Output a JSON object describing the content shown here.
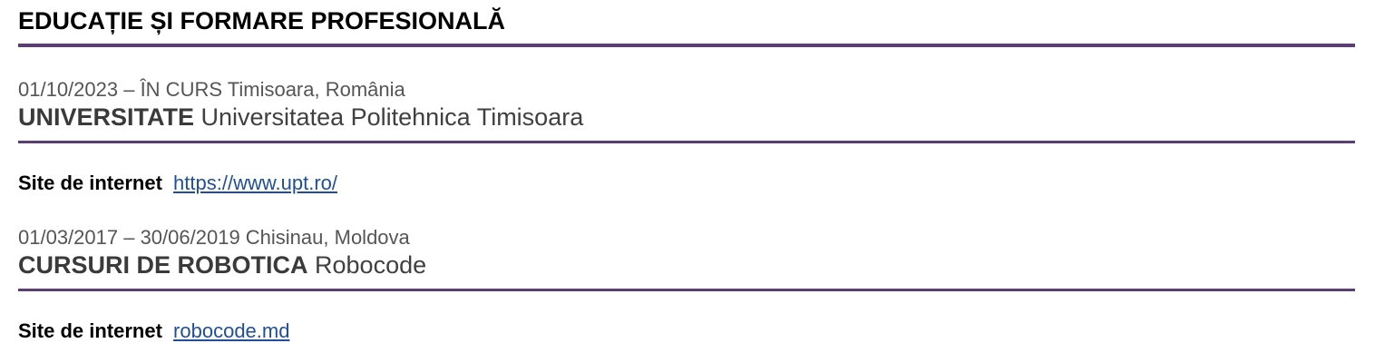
{
  "section": {
    "title": "EDUCAȚIE ȘI FORMARE PROFESIONALĂ"
  },
  "entries": [
    {
      "meta": "01/10/2023 – ÎN CURS Timisoara, România",
      "qualification": "UNIVERSITATE",
      "institution": "Universitatea Politehnica Timisoara",
      "site_label": "Site de internet",
      "site_url": "https://www.upt.ro/"
    },
    {
      "meta": "01/03/2017 – 30/06/2019 Chisinau, Moldova",
      "qualification": "CURSURI DE ROBOTICA",
      "institution": "Robocode",
      "site_label": "Site de internet",
      "site_url": "robocode.md"
    }
  ],
  "colors": {
    "rule": "#5b3f74",
    "link": "#1f4e9c",
    "meta_text": "#555555"
  }
}
